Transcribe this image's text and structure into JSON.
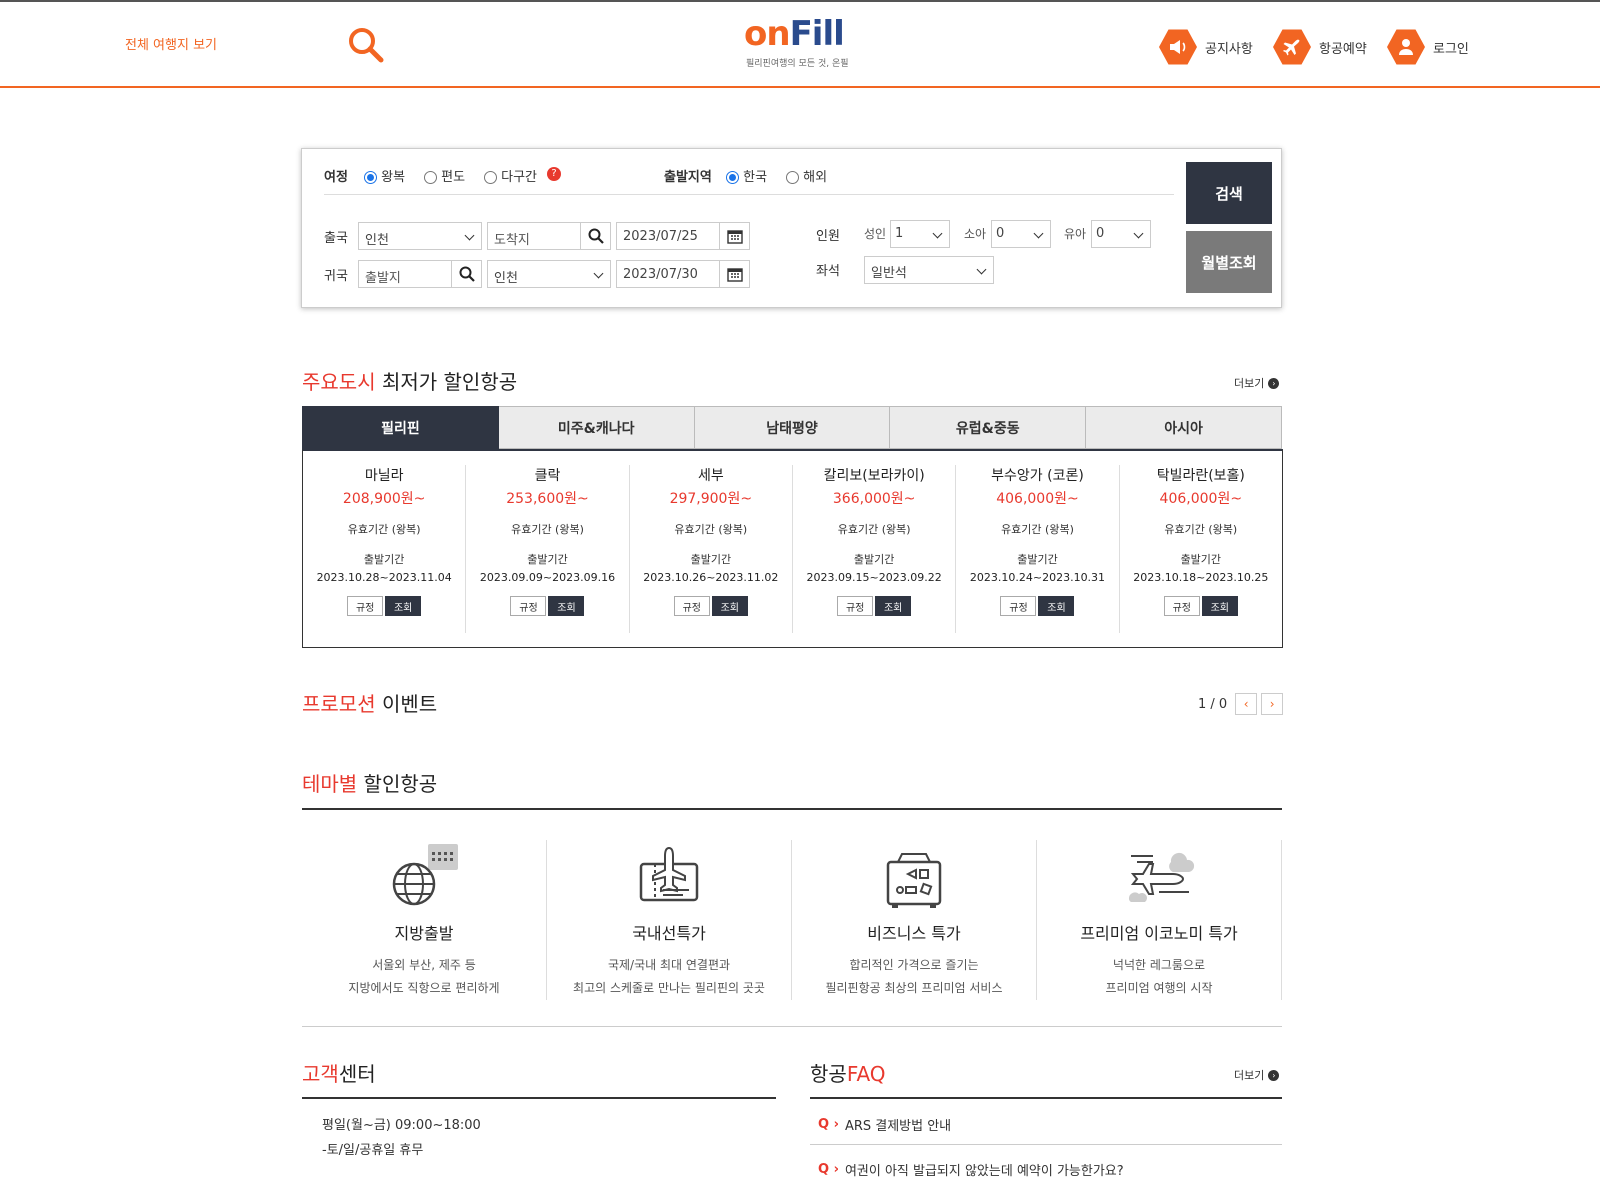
{
  "header": {
    "all_destinations": "전체 여행지 보기",
    "logo_main_on": "on",
    "logo_main_fill": "Fill",
    "logo_sub": "필리핀여행의 모든 것, 온필",
    "nav": [
      {
        "label": "공지사항",
        "icon": "megaphone-icon"
      },
      {
        "label": "항공예약",
        "icon": "airplane-icon"
      },
      {
        "label": "로그인",
        "icon": "user-icon"
      }
    ],
    "accent_color": "#f26522"
  },
  "search": {
    "trip_label": "여정",
    "trip_options": [
      "왕복",
      "편도",
      "다구간"
    ],
    "trip_selected": "왕복",
    "depart_region_label": "출발지역",
    "region_options": [
      "한국",
      "해외"
    ],
    "region_selected": "한국",
    "out_label": "출국",
    "out_from": "인천",
    "out_to_placeholder": "도착지",
    "out_date": "2023/07/25",
    "ret_label": "귀국",
    "ret_from_placeholder": "출발지",
    "ret_to": "인천",
    "ret_date": "2023/07/30",
    "pax_label": "인원",
    "adult_label": "성인",
    "adult_value": "1",
    "child_label": "소아",
    "child_value": "0",
    "infant_label": "유아",
    "infant_value": "0",
    "seat_label": "좌석",
    "seat_value": "일반석",
    "search_button": "검색",
    "monthly_button": "월별조회"
  },
  "deals": {
    "title_red": "주요도시",
    "title_rest": " 최저가 할인항공",
    "more": "더보기",
    "tabs": [
      "필리핀",
      "미주&캐나다",
      "남태평양",
      "유럽&중동",
      "아시아"
    ],
    "active_tab": "필리핀",
    "valid_label": "유효기간 (왕복)",
    "dep_label": "출발기간",
    "rule_button": "규정",
    "view_button": "조회",
    "cards": [
      {
        "city": "마닐라",
        "price": "208,900원~",
        "range": "2023.10.28~2023.11.04"
      },
      {
        "city": "클락",
        "price": "253,600원~",
        "range": "2023.09.09~2023.09.16"
      },
      {
        "city": "세부",
        "price": "297,900원~",
        "range": "2023.10.26~2023.11.02"
      },
      {
        "city": "칼리보(보라카이)",
        "price": "366,000원~",
        "range": "2023.09.15~2023.09.22"
      },
      {
        "city": "부수앙가 (코론)",
        "price": "406,000원~",
        "range": "2023.10.24~2023.10.31"
      },
      {
        "city": "탁빌라란(보홀)",
        "price": "406,000원~",
        "range": "2023.10.18~2023.10.25"
      }
    ]
  },
  "promo": {
    "title_red": "프로모션",
    "title_rest": " 이벤트",
    "page": "1 / 0"
  },
  "theme": {
    "title_red": "테마별",
    "title_rest": " 할인항공",
    "items": [
      {
        "title": "지방출발",
        "desc1": "서울외 부산, 제주 등",
        "desc2": "지방에서도 직항으로 편리하게",
        "icon": "globe-calendar-icon"
      },
      {
        "title": "국내선특가",
        "desc1": "국제/국내 최대 연결편과",
        "desc2": "최고의 스케줄로 만나는 필리핀의 곳곳",
        "icon": "ticket-plane-icon"
      },
      {
        "title": "비즈니스 특가",
        "desc1": "합리적인 가격으로 즐기는",
        "desc2": "필리핀항공 최상의 프리미엄 서비스",
        "icon": "business-seat-icon"
      },
      {
        "title": "프리미엄 이코노미 특가",
        "desc1": "넉넉한 레그룸으로",
        "desc2": "프리미엄 여행의 시작",
        "icon": "plane-cloud-icon"
      }
    ]
  },
  "customer": {
    "title_red": "고객",
    "title_rest": "센터",
    "hours": "평일(월~금) 09:00~18:00",
    "closed": "-토/일/공휴일 휴무"
  },
  "faq": {
    "title_dark": "항공",
    "title_red": "FAQ",
    "more": "더보기",
    "items": [
      "ARS 결제방법 안내",
      "여권이 아직 발급되지 않았는데 예약이 가능한가요?"
    ]
  }
}
